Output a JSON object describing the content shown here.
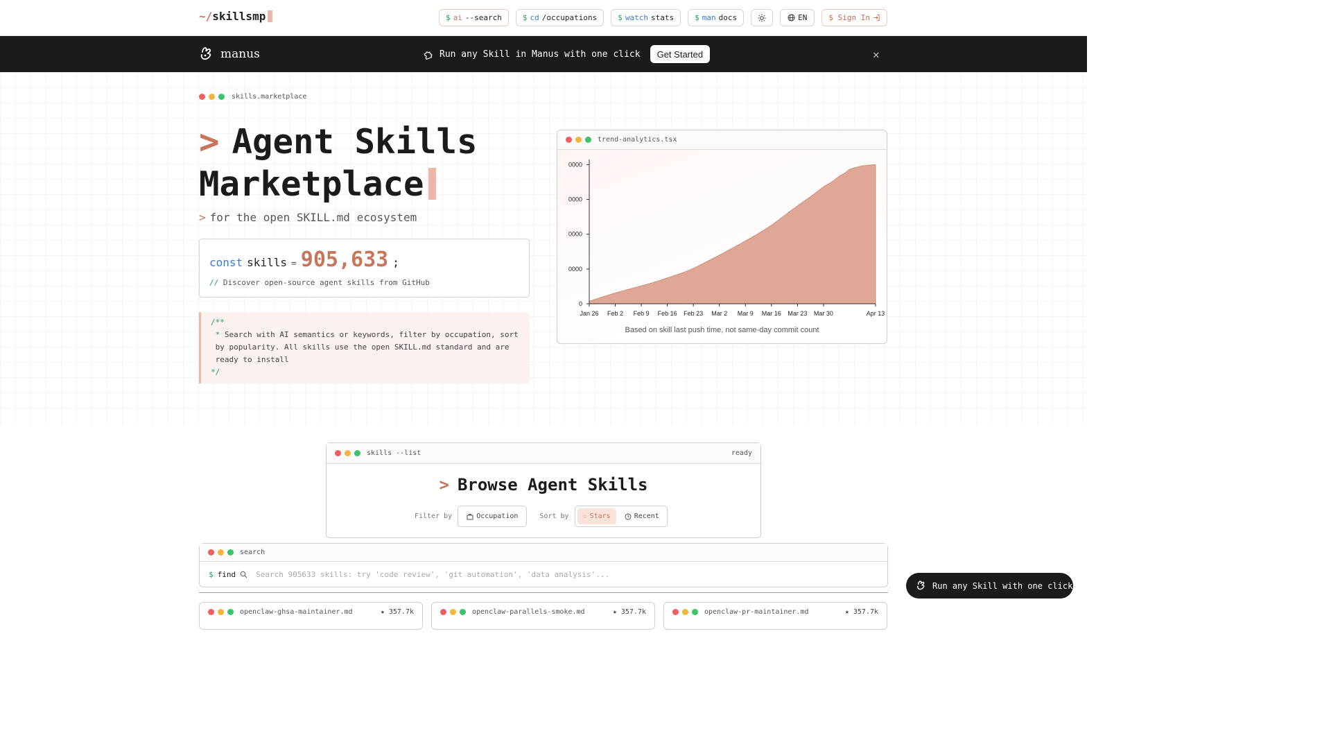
{
  "nav": {
    "logo_tilde": "~/",
    "logo_name": "skillsmp",
    "buttons": [
      {
        "dollar": "$",
        "cmd": "ai",
        "arg": "--search"
      },
      {
        "dollar": "$",
        "cmd": "cd",
        "arg": "/occupations"
      },
      {
        "dollar": "$",
        "cmd": "watch",
        "arg": "stats"
      },
      {
        "dollar": "$",
        "cmd": "man",
        "arg": "docs"
      }
    ],
    "theme_icon": "sun-icon",
    "lang": "EN",
    "signin": "$ Sign In"
  },
  "banner": {
    "brand": "manus",
    "message": "Run any Skill in Manus with one click",
    "cta": "Get Started"
  },
  "hero": {
    "breadcrumb": "skills.marketplace",
    "title_prompt": ">",
    "title_line1": "Agent Skills",
    "title_line2": "Marketplace",
    "subtitle_prompt": ">",
    "subtitle": "for the open SKILL.md ecosystem",
    "const_kw": "const",
    "const_name": "skills",
    "const_eq": "=",
    "const_value": "905,633",
    "const_semi": ";",
    "comment_slashes": "//",
    "comment_text": "Discover open-source agent skills from GitHub",
    "doc_open": "/**",
    "doc_star": "*",
    "doc_line1": "Search with AI semantics or keywords, filter by occupation, sort",
    "doc_line2": "by popularity. All skills use the open SKILL.md standard and are",
    "doc_line3": "ready to install",
    "doc_close": "*/"
  },
  "chart_card": {
    "filename": "trend-analytics.tsx",
    "footnote": "Based on skill last push time, not same-day commit count"
  },
  "chart_data": {
    "type": "area",
    "title": "",
    "xlabel": "",
    "ylabel": "",
    "y_ticks": [
      "0",
      "0000",
      "0000",
      "0000",
      "0000"
    ],
    "x_ticks": [
      "Jan 26",
      "Feb 2",
      "Feb 9",
      "Feb 16",
      "Feb 23",
      "Mar 2",
      "Mar 9",
      "Mar 16",
      "Mar 23",
      "Mar 30",
      "Apr 13"
    ],
    "x_tick_positions": [
      0,
      7,
      14,
      21,
      28,
      35,
      42,
      49,
      56,
      63,
      77
    ],
    "ylim": [
      0,
      4
    ],
    "series": [
      {
        "x": [
          0,
          3,
          7,
          10,
          14,
          18,
          21,
          25,
          28,
          31,
          35,
          39,
          42,
          46,
          49,
          52,
          56,
          60,
          63,
          65,
          67,
          69,
          70,
          72,
          74,
          77
        ],
        "values": [
          0.08,
          0.2,
          0.35,
          0.45,
          0.58,
          0.72,
          0.84,
          1.0,
          1.15,
          1.33,
          1.58,
          1.84,
          2.04,
          2.32,
          2.55,
          2.82,
          3.18,
          3.52,
          3.8,
          3.94,
          4.12,
          4.27,
          4.36,
          4.44,
          4.49,
          4.52
        ]
      }
    ],
    "colors": {
      "fill": "#dfa796",
      "stroke": "#cf8f7b"
    },
    "grid": false
  },
  "browse": {
    "label": "skills --list",
    "status": "ready",
    "prompt": ">",
    "title": "Browse Agent Skills",
    "filter_label": "Filter by",
    "filter_value": "Occupation",
    "sort_label": "Sort by",
    "sort_stars": "Stars",
    "sort_recent": "Recent"
  },
  "search": {
    "label": "search",
    "prompt_dollar": "$",
    "prompt_cmd": "find",
    "placeholder": "Search 905633 skills: try 'code review', 'git automation', 'data analysis'..."
  },
  "cards": [
    {
      "name": "openclaw-ghsa-maintainer.md",
      "stars": "357.7k"
    },
    {
      "name": "openclaw-parallels-smoke.md",
      "stars": "357.7k"
    },
    {
      "name": "openclaw-pr-maintainer.md",
      "stars": "357.7k"
    }
  ],
  "floating": {
    "label": "Run any Skill with one click"
  }
}
